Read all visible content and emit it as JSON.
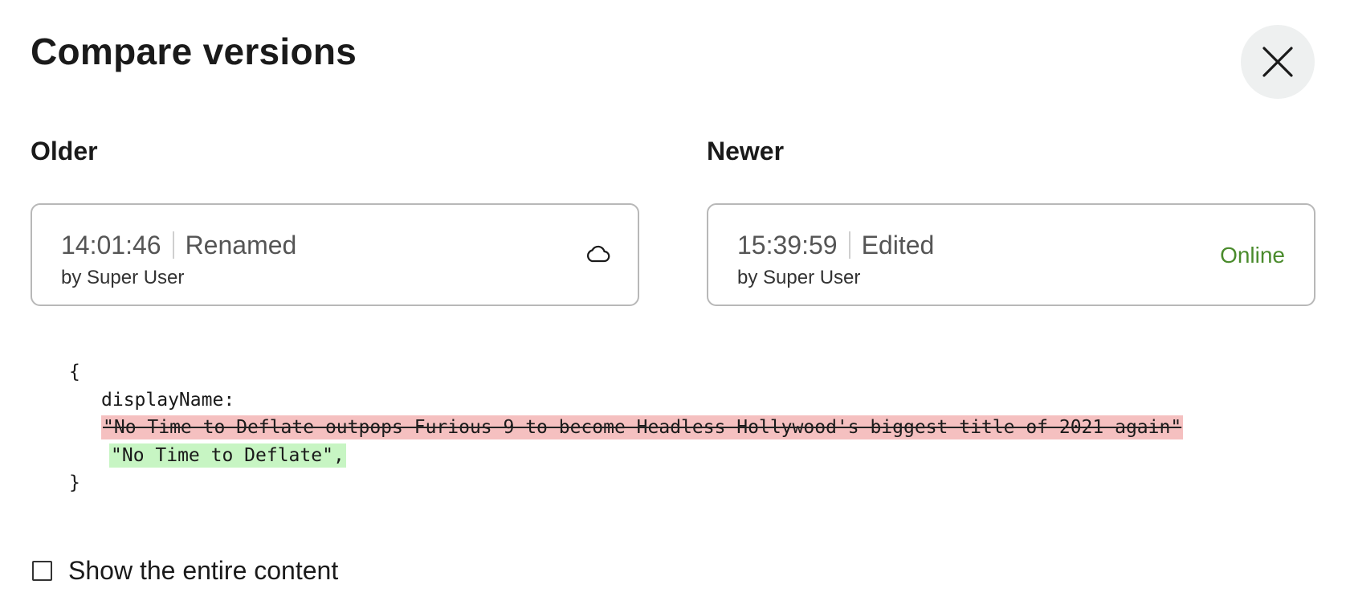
{
  "dialog": {
    "title": "Compare versions",
    "close_icon": "close-icon"
  },
  "older": {
    "label": "Older",
    "time": "14:01:46",
    "action": "Renamed",
    "author": "by Super User",
    "status_icon": "cloud-icon"
  },
  "newer": {
    "label": "Newer",
    "time": "15:39:59",
    "action": "Edited",
    "author": "by Super User",
    "status": "Online",
    "status_color": "#4a8b2c"
  },
  "diff": {
    "open_brace": "{",
    "key": "displayName:",
    "removed": "\"No Time to Deflate outpops Furious 9 to become Headless Hollywood's biggest title of 2021 again\"",
    "added": "\"No Time to Deflate\",",
    "close_brace": "}",
    "removed_color": "#f5c0c0",
    "added_color": "#c7f5c3"
  },
  "options": {
    "show_entire_label": "Show the entire content",
    "show_entire_checked": false
  }
}
